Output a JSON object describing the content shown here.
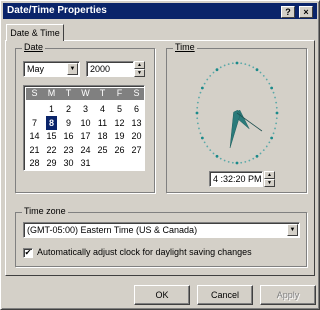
{
  "window": {
    "title": "Date/Time Properties",
    "help_button": "?",
    "close_button": "×"
  },
  "tabs": [
    {
      "label": "Date & Time"
    }
  ],
  "date_group": {
    "label": "Date",
    "month": "May",
    "year": "2000",
    "weekday_headers": [
      "S",
      "M",
      "T",
      "W",
      "T",
      "F",
      "S"
    ],
    "weeks": [
      [
        "",
        "1",
        "2",
        "3",
        "4",
        "5",
        "6"
      ],
      [
        "7",
        "8",
        "9",
        "10",
        "11",
        "12",
        "13"
      ],
      [
        "14",
        "15",
        "16",
        "17",
        "18",
        "19",
        "20"
      ],
      [
        "21",
        "22",
        "23",
        "24",
        "25",
        "26",
        "27"
      ],
      [
        "28",
        "29",
        "30",
        "31",
        "",
        "",
        ""
      ]
    ],
    "selected_day": "8"
  },
  "time_group": {
    "label": "Time",
    "time_value": "4 :32:20 PM",
    "clock": {
      "hour": 4,
      "minute": 32,
      "second": 20
    }
  },
  "timezone_group": {
    "label": "Time zone",
    "selected": "(GMT-05:00) Eastern Time (US & Canada)",
    "dst_checkbox_label": "Automatically adjust clock for daylight saving changes",
    "dst_checked": true
  },
  "buttons": {
    "ok": "OK",
    "cancel": "Cancel",
    "apply": "Apply"
  },
  "colors": {
    "titlebar": "#0a246a",
    "face": "#d4d0c8",
    "clock_hands": "#2a7a7a",
    "clock_dots": "#1a8a8a",
    "selected_day": "#0a246a"
  }
}
